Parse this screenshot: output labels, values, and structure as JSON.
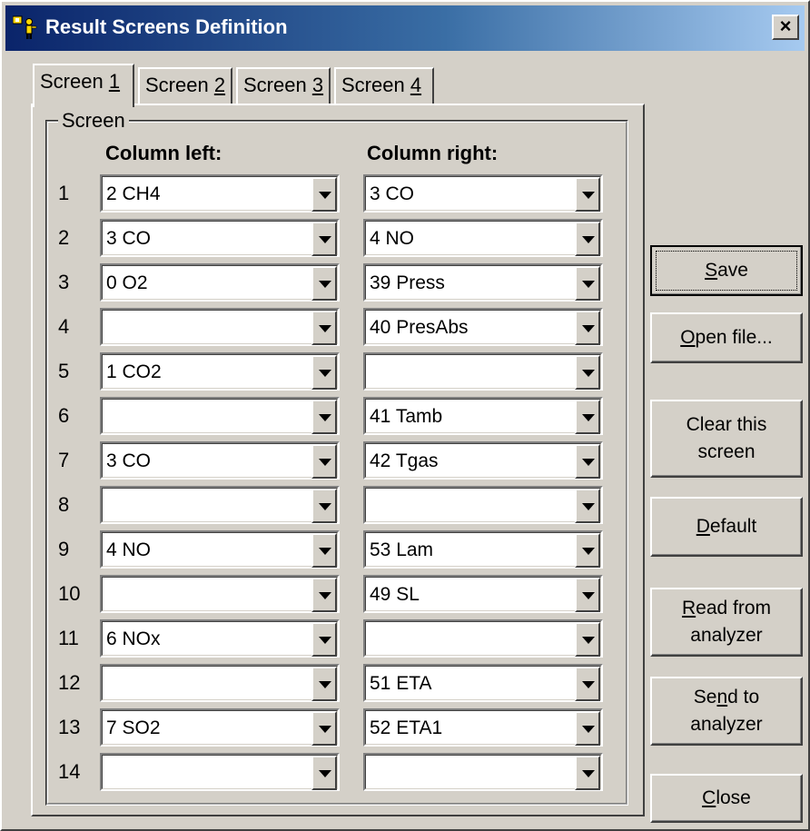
{
  "window": {
    "title": "Result Screens Definition",
    "close_glyph": "×"
  },
  "tabs": [
    {
      "prefix": "Screen ",
      "accel": "1",
      "active": true
    },
    {
      "prefix": "Screen ",
      "accel": "2",
      "active": false
    },
    {
      "prefix": "Screen ",
      "accel": "3",
      "active": false
    },
    {
      "prefix": "Screen ",
      "accel": "4",
      "active": false
    }
  ],
  "group": {
    "label": "Screen",
    "column_left_header": "Column left:",
    "column_right_header": "Column right:"
  },
  "rows": [
    {
      "num": "1",
      "left": "2 CH4",
      "right": "3 CO"
    },
    {
      "num": "2",
      "left": "3 CO",
      "right": "4 NO"
    },
    {
      "num": "3",
      "left": "0 O2",
      "right": "39 Press"
    },
    {
      "num": "4",
      "left": "",
      "right": "40 PresAbs"
    },
    {
      "num": "5",
      "left": "1 CO2",
      "right": ""
    },
    {
      "num": "6",
      "left": "",
      "right": "41 Tamb"
    },
    {
      "num": "7",
      "left": "3 CO",
      "right": "42 Tgas"
    },
    {
      "num": "8",
      "left": "",
      "right": ""
    },
    {
      "num": "9",
      "left": "4 NO",
      "right": "53 Lam"
    },
    {
      "num": "10",
      "left": "",
      "right": "49 SL"
    },
    {
      "num": "11",
      "left": "6 NOx",
      "right": ""
    },
    {
      "num": "12",
      "left": "",
      "right": "51 ETA"
    },
    {
      "num": "13",
      "left": "7 SO2",
      "right": "52 ETA1"
    },
    {
      "num": "14",
      "left": "",
      "right": ""
    }
  ],
  "buttons": [
    {
      "name": "save-button",
      "label": "Save",
      "accel": "S"
    },
    {
      "name": "open-file-button",
      "label": "Open file...",
      "accel": "O"
    },
    {
      "name": "clear-this-screen-button",
      "label": "Clear this\nscreen",
      "accel": ""
    },
    {
      "name": "default-button",
      "label": "Default",
      "accel": "D"
    },
    {
      "name": "read-from-analyzer-button",
      "label": "Read from\nanalyzer",
      "accel": "R"
    },
    {
      "name": "send-to-analyzer-button",
      "label": "Send to\nanalyzer",
      "accel": "n"
    },
    {
      "name": "close-button",
      "label": "Close",
      "accel": "C"
    }
  ],
  "colors": {
    "title_start": "#0a246a",
    "title_end": "#a6caf0",
    "face": "#d4d0c8"
  }
}
